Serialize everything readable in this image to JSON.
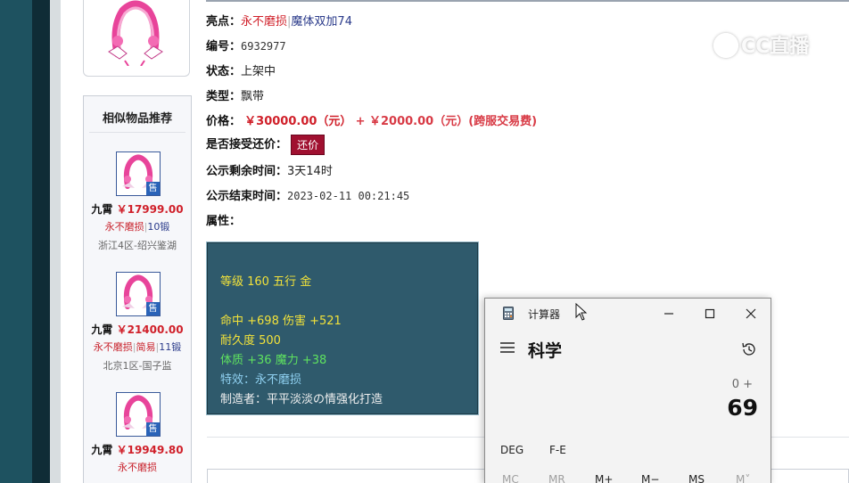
{
  "watermark": {
    "text": "CC直播"
  },
  "similar": {
    "title": "相似物品推荐",
    "sale_badge": "售",
    "items": [
      {
        "name": "九霄",
        "price": "￥17999.00",
        "tags": [
          {
            "text": "永不磨损",
            "color": "red"
          },
          {
            "text": "10锻",
            "color": "blue"
          }
        ],
        "server": "浙江4区-绍兴鉴湖"
      },
      {
        "name": "九霄",
        "price": "￥21400.00",
        "tags": [
          {
            "text": "永不磨损",
            "color": "red"
          },
          {
            "text": "简易",
            "color": "red"
          },
          {
            "text": "11锻",
            "color": "blue"
          }
        ],
        "server": "北京1区-国子监"
      },
      {
        "name": "九霄",
        "price": "￥19949.80",
        "tags": [
          {
            "text": "永不磨损",
            "color": "red"
          }
        ],
        "server": ""
      }
    ]
  },
  "details": {
    "highlight_label": "亮点：",
    "highlight_a": "永不磨损",
    "highlight_b": "魔体双加74",
    "id_label": "编号：",
    "id_value": "6932977",
    "status_label": "状态：",
    "status_value": "上架中",
    "type_label": "类型：",
    "type_value": "飘带",
    "price_label": "价格：",
    "price_main": "￥30000.00（元）",
    "price_extra": "+ ￥2000.00（元）(跨服交易费)",
    "haggle_label": "是否接受还价：",
    "haggle_button": "还价",
    "remain_label": "公示剩余时间：",
    "remain_value": "3天14时",
    "end_label": "公示结束时间：",
    "end_value": "2023-02-11 00:21:45",
    "attr_label": "属性："
  },
  "attributes": {
    "level_line": "等级 160 五行 金",
    "hit_line": "命中 +698 伤害 +521",
    "durability_line": "耐久度 500",
    "stat_line": "体质 +36 魔力 +38",
    "effect_line": "特效：永不磨损",
    "maker_line": "制造者：平平淡淡の情强化打造"
  },
  "calculator": {
    "title": "计算器",
    "mode": "科学",
    "expression": "0 +",
    "result": "69",
    "deg": "DEG",
    "fe": "F-E",
    "memory": [
      "MC",
      "MR",
      "M+",
      "M−",
      "MS",
      "M˅"
    ]
  },
  "colors": {
    "accent_red": "#d0202a",
    "attr_bg": "#2f5a6c",
    "haggle_bg": "#a01030"
  }
}
